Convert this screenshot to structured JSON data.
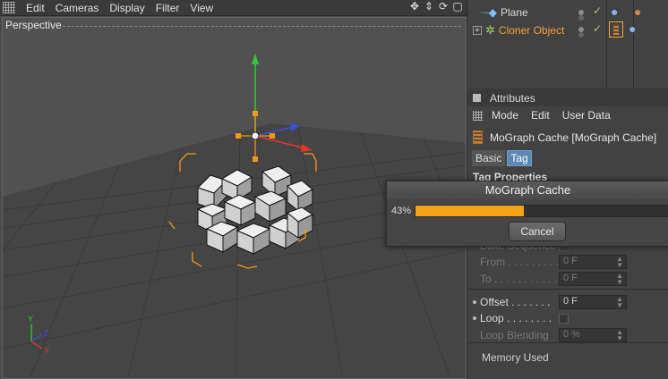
{
  "viewport": {
    "menu": [
      "Edit",
      "Cameras",
      "Display",
      "Filter",
      "View"
    ],
    "view_name": "Perspective",
    "nav_icons": [
      "move-icon",
      "zoom-icon",
      "rotate-icon",
      "maximize-icon"
    ],
    "axis_labels": {
      "y": "Y",
      "z": "Z",
      "x": "X"
    }
  },
  "object_manager": {
    "objects": [
      {
        "name": "Plane",
        "color": "#d9d9d9",
        "icon": "plane-icon"
      },
      {
        "name": "Cloner Object",
        "color": "#f2a33a",
        "icon": "cloner-icon"
      }
    ]
  },
  "attributes": {
    "title": "Attributes",
    "menu": [
      "Mode",
      "Edit",
      "User Data"
    ],
    "object_title": "MoGraph Cache [MoGraph Cache]",
    "tabs": [
      "Basic",
      "Tag"
    ],
    "active_tab": "Tag",
    "section": "Tag Properties",
    "bake_sequence": "Bake Sequence",
    "from_label": "From . . . . . . . . .",
    "from_value": "0 F",
    "to_label": "To . . . . . . . . . . .",
    "to_value": "0 F",
    "offset_label": "Offset . . . . . . .",
    "offset_value": "0 F",
    "loop_label": "Loop . . . . . . . .",
    "loop_blending_label": "Loop Blending",
    "loop_blending_value": "0 %",
    "memory_used": "Memory Used"
  },
  "dialog": {
    "title": "MoGraph Cache",
    "progress_label": "43%",
    "progress": 0.43,
    "cancel": "Cancel",
    "bar_color": "#f4a41a"
  }
}
